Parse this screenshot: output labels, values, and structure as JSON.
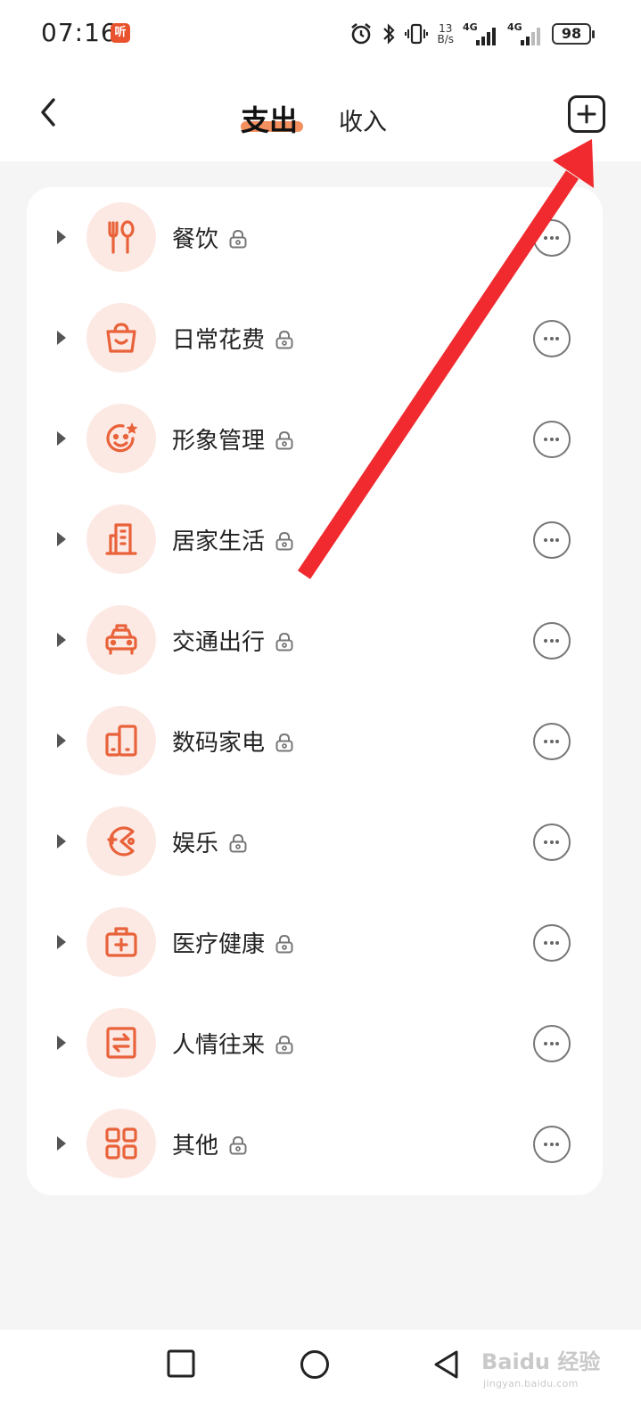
{
  "status_bar": {
    "time": "07:16",
    "app_badge": "听",
    "net_speed_value": "13",
    "net_speed_unit": "B/s",
    "signal1_label": "4G",
    "signal2_label": "4G",
    "battery": "98"
  },
  "header": {
    "tab_expense": "支出",
    "tab_income": "收入"
  },
  "categories": [
    {
      "name": "餐饮",
      "icon": "utensils-icon"
    },
    {
      "name": "日常花费",
      "icon": "shopping-basket-icon"
    },
    {
      "name": "形象管理",
      "icon": "smiley-star-icon"
    },
    {
      "name": "居家生活",
      "icon": "building-icon"
    },
    {
      "name": "交通出行",
      "icon": "taxi-icon"
    },
    {
      "name": "数码家电",
      "icon": "devices-icon"
    },
    {
      "name": "娱乐",
      "icon": "game-icon"
    },
    {
      "name": "医疗健康",
      "icon": "medical-kit-icon"
    },
    {
      "name": "人情往来",
      "icon": "exchange-icon"
    },
    {
      "name": "其他",
      "icon": "grid-icon"
    }
  ],
  "colors": {
    "accent": "#e8623a",
    "icon_bg": "#fde9e4",
    "annotation_arrow": "#f02a2e"
  },
  "watermark": {
    "brand": "Baidu 经验",
    "url": "jingyan.baidu.com"
  }
}
